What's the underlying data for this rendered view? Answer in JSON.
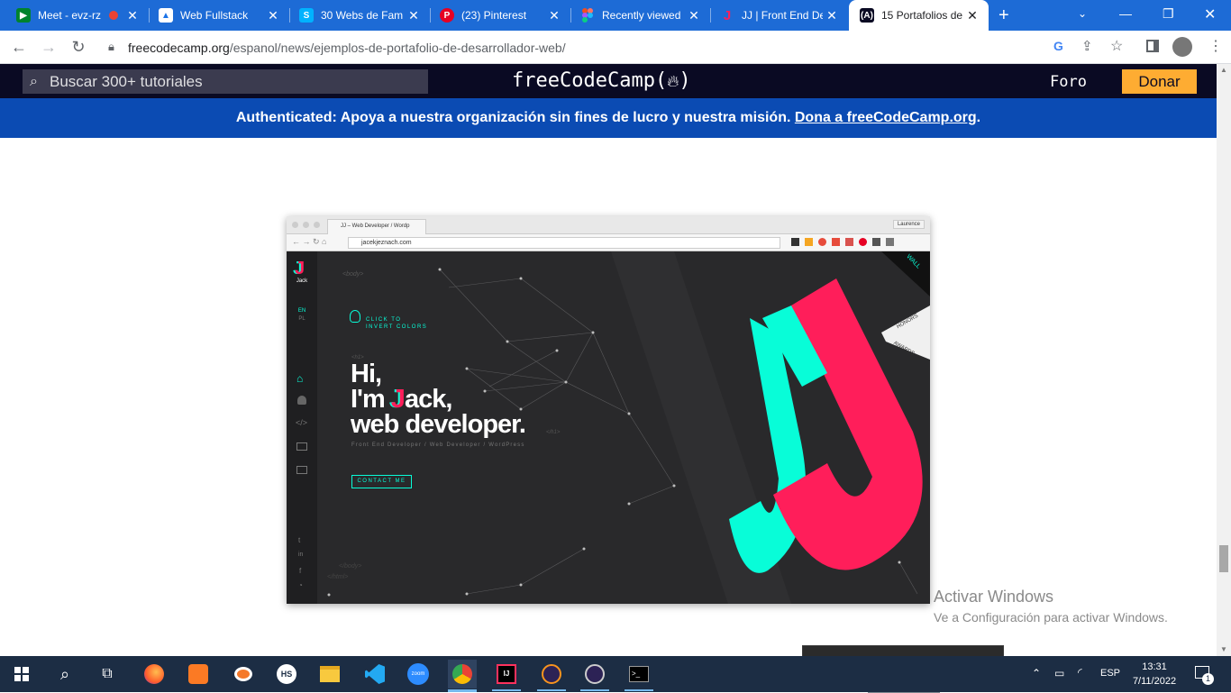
{
  "browser": {
    "tabs": [
      {
        "title": "Meet - evz-rz",
        "icon": "google-meet-icon"
      },
      {
        "title": "Web Fullstack",
        "icon": "classroom-icon"
      },
      {
        "title": "30 Webs de Fam",
        "icon": "site-icon"
      },
      {
        "title": "(23) Pinterest",
        "icon": "pinterest-icon"
      },
      {
        "title": "Recently viewed",
        "icon": "figma-icon"
      },
      {
        "title": "JJ | Front End De",
        "icon": "jj-icon"
      },
      {
        "title": "15 Portafolios de",
        "icon": "freecodecamp-icon"
      }
    ],
    "new_tab": "+",
    "url_host": "freecodecamp.org",
    "url_path": "/espanol/news/ejemplos-de-portafolio-de-desarrollador-web/"
  },
  "site": {
    "search_placeholder": "Buscar 300+ tutoriales",
    "logo": "freeCodeCamp(🔥)",
    "logo_text": "freeCodeCamp(",
    "logo_end": ")",
    "foro": "Foro",
    "donar": "Donar",
    "banner_text": "Authenticated: Apoya a nuestra organización sin fines de lucro y nuestra misión.",
    "banner_link": "Dona a freeCodeCamp.org",
    "banner_end": "."
  },
  "article_image": {
    "mini_tab": "JJ – Web Developer / Wordp",
    "mini_user": "Laurence",
    "mini_url": "jacekjeznach.com",
    "logo_name": "Jack",
    "lang_en": "EN",
    "lang_pl": "PL",
    "invert_1": "CLICK TO",
    "invert_2": "INVERT COLORS",
    "hi": "Hi,",
    "im_pre": "I'm ",
    "im_j": "J",
    "im_rest": "ack,",
    "role": "web developer.",
    "subtitle": "Front End Developer / Web Developer / WordPress",
    "contact": "CONTACT ME",
    "tag_body": "<body>",
    "tag_h1": "<h1>",
    "tag_h1_close": "</h1>",
    "tag_body_close": "</body>",
    "tag_html_close": "</html>",
    "wall": "WALL",
    "honors": "HONORS",
    "awards": "AWARDS",
    "accent_pink": "#ff1e5a",
    "accent_cyan": "#08fdd8"
  },
  "watermark": {
    "line1": "Activar Windows",
    "line2": "Ve a Configuración para activar Windows."
  },
  "taskbar": {
    "lang": "ESP",
    "time": "13:31",
    "date": "7/11/2022",
    "notifications": "1"
  }
}
